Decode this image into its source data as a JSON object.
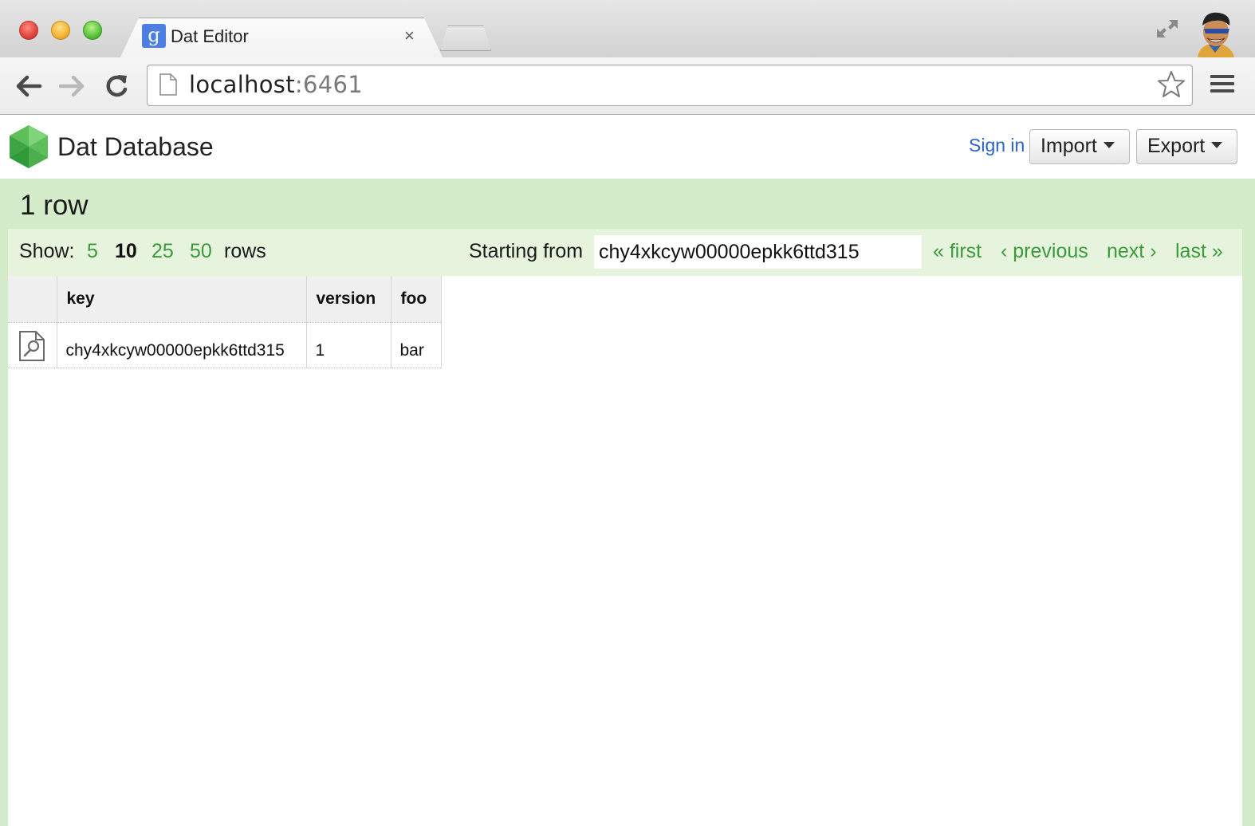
{
  "browser": {
    "tab_title": "Dat Editor",
    "tab_favicon_letter": "g",
    "tab_close_glyph": "×",
    "url_host": "localhost",
    "url_port": ":6461"
  },
  "app": {
    "title": "Dat Database",
    "signin_label": "Sign in",
    "import_label": "Import",
    "export_label": "Export",
    "accent_color": "#3c9a3c",
    "frame_color": "#d5eccb"
  },
  "summary": {
    "row_count_text": "1 row"
  },
  "controls": {
    "show_label": "Show:",
    "sizes": [
      "5",
      "10",
      "25",
      "50"
    ],
    "active_size": "10",
    "rows_word": "rows",
    "starting_label": "Starting from",
    "starting_value": "chy4xkcyw00000epkk6ttd315",
    "first_label": "« first",
    "previous_label": "‹ previous",
    "next_label": "next ›",
    "last_label": "last »"
  },
  "table": {
    "headers": [
      "key",
      "version",
      "foo"
    ],
    "rows": [
      {
        "key": "chy4xkcyw00000epkk6ttd315",
        "version": "1",
        "foo": "bar"
      }
    ]
  },
  "icons": {
    "back": "arrow-left-icon",
    "forward": "arrow-right-icon",
    "reload": "reload-icon",
    "star": "star-icon",
    "menu": "hamburger-menu-icon",
    "row_view": "document-search-icon"
  }
}
